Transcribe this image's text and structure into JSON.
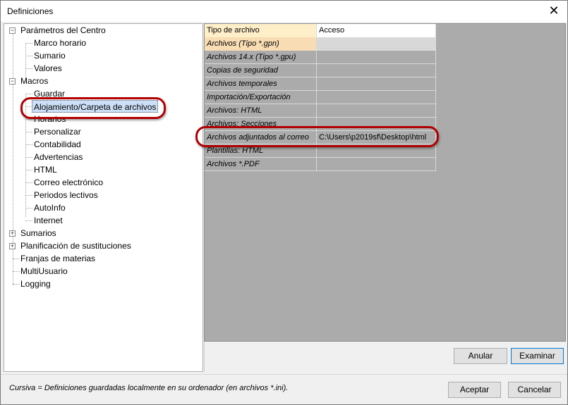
{
  "window": {
    "title": "Definiciones",
    "close_glyph": "✕"
  },
  "tree": {
    "items": [
      {
        "label": "Parámetros del Centro",
        "expander": "−"
      },
      {
        "label": "Marco horario"
      },
      {
        "label": "Sumario"
      },
      {
        "label": "Valores"
      },
      {
        "label": "Macros",
        "expander": "−"
      },
      {
        "label": "Guardar"
      },
      {
        "label": "Alojamiento/Carpeta de archivos",
        "selected": true
      },
      {
        "label": "Horarios"
      },
      {
        "label": "Personalizar"
      },
      {
        "label": "Contabilidad"
      },
      {
        "label": "Advertencias"
      },
      {
        "label": "HTML"
      },
      {
        "label": "Correo electrónico"
      },
      {
        "label": "Periodos lectivos"
      },
      {
        "label": "AutoInfo"
      },
      {
        "label": "Internet"
      },
      {
        "label": "Sumarios",
        "expander": "+"
      },
      {
        "label": "Planificación de sustituciones",
        "expander": "+"
      },
      {
        "label": "Franjas de materias"
      },
      {
        "label": "MultiUsuario"
      },
      {
        "label": "Logging"
      }
    ]
  },
  "grid": {
    "headers": [
      "Tipo de archivo",
      "Acceso"
    ],
    "rows": [
      {
        "tipo": "Archivos (Tipo *.gpn)",
        "acceso": ""
      },
      {
        "tipo": "Archivos 14.x (Tipo *.gpu)",
        "acceso": ""
      },
      {
        "tipo": "Copias de seguridad",
        "acceso": ""
      },
      {
        "tipo": "Archivos temporales",
        "acceso": ""
      },
      {
        "tipo": "Importación/Exportación",
        "acceso": ""
      },
      {
        "tipo": "Archivos: HTML",
        "acceso": ""
      },
      {
        "tipo": "Archivos: Secciones",
        "acceso": ""
      },
      {
        "tipo": "Archivos adjuntados al correo",
        "acceso": "C:\\Users\\p2019sf\\Desktop\\html"
      },
      {
        "tipo": "Plantillas: HTML",
        "acceso": ""
      },
      {
        "tipo": "Archivos *.PDF",
        "acceso": ""
      }
    ]
  },
  "buttons": {
    "anular": "Anular",
    "examinar": "Examinar",
    "aceptar": "Aceptar",
    "cancelar": "Cancelar"
  },
  "footnote": "Cursiva = Definiciones guardadas localmente en su ordenador (en archivos *.ini).",
  "colors": {
    "annotation": "#b00000",
    "selection": "#cce0f7",
    "header_highlight": "#ffefc9"
  }
}
